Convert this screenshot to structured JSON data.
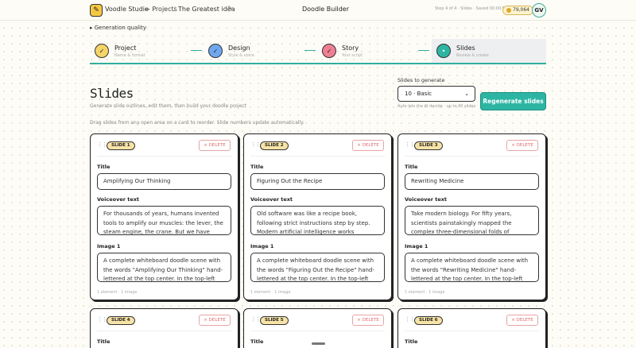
{
  "topbar": {
    "brand": "Voodle Studio",
    "back_label": "← Projects",
    "crumb_sep": "/",
    "project_title": "The Greatest idea",
    "builder_title": "Doodle Builder",
    "step_meta": "Step 4 of 4 · Slides · Saved 00:00:51",
    "credits": "79,064",
    "avatar": "GV"
  },
  "quality_toggle": "▸ Generation quality",
  "stepper": {
    "steps": [
      {
        "title": "Project",
        "sub": "Name & format",
        "color": "#f5d46a",
        "mark": "✓"
      },
      {
        "title": "Design",
        "sub": "Style & voice",
        "color": "#6ea7ee",
        "mark": "✓"
      },
      {
        "title": "Story",
        "sub": "Your script",
        "color": "#f07f92",
        "mark": "✓"
      },
      {
        "title": "Slides",
        "sub": "Review & create",
        "color": "#2db5a3",
        "mark": "•"
      }
    ]
  },
  "header": {
    "title": "Slides",
    "subtitle": "Generate slide outlines, edit them, then build your doodle project",
    "drag_hint": "Drag slides from any open area on a card to reorder. Slide numbers update automatically.",
    "gen_label": "Slides to generate",
    "gen_value": "10 · Basic",
    "gen_help": "Auto lets the AI decide · up to 40 slides",
    "regen_label": "Regenerate slides"
  },
  "card_labels": {
    "delete": "× DELETE",
    "title": "Title",
    "voiceover": "Voiceover text",
    "image": "Image 1",
    "meta": "1 element · 1 image"
  },
  "slides": [
    {
      "badge": "SLIDE 1",
      "title": "Amplifying Our Thinking",
      "voiceover": "For thousands of years, humans invented tools to amplify our muscles: the lever, the steam engine, the crane. But we have quietly",
      "image": "A complete whiteboard doodle scene with the words \"Amplifying Our Thinking\" hand-lettered at the top center. In the top-left"
    },
    {
      "badge": "SLIDE 2",
      "title": "Figuring Out the Recipe",
      "voiceover": "Old software was like a recipe book, following strict instructions step by step. Modern artificial intelligence works",
      "image": "A complete whiteboard doodle scene with the words \"Figuring Out the Recipe\" hand-lettered at the top center. In the top-left"
    },
    {
      "badge": "SLIDE 3",
      "title": "Rewriting Medicine",
      "voiceover": "Take modern biology. For fifty years, scientists painstakingly mapped the complex three-dimensional folds of proteins, one slow",
      "image": "A complete whiteboard doodle scene with the words \"Rewriting Medicine\" hand-lettered at the top center. In the top-left"
    },
    {
      "badge": "SLIDE 4"
    },
    {
      "badge": "SLIDE 5"
    },
    {
      "badge": "SLIDE 6"
    }
  ]
}
